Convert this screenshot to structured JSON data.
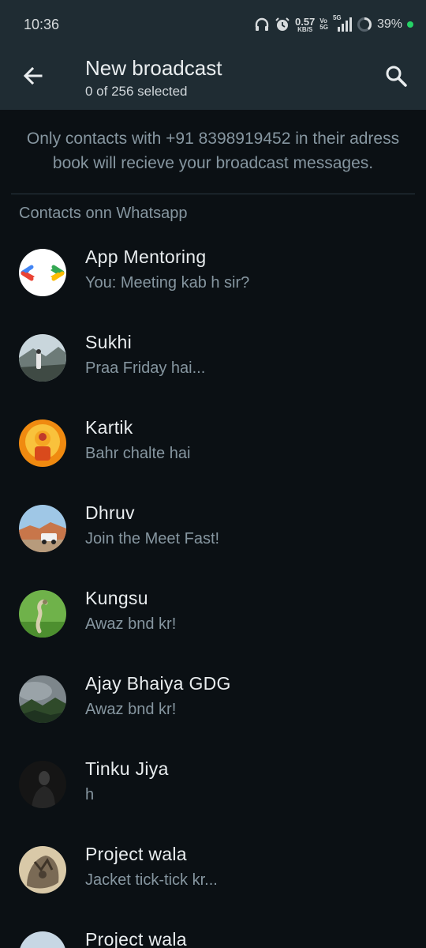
{
  "status_bar": {
    "time": "10:36",
    "speed_value": "0.57",
    "speed_unit": "KB/S",
    "volte_top": "Vo",
    "volte_bottom": "5G",
    "network": "5G",
    "battery": "39%"
  },
  "header": {
    "title": "New broadcast",
    "subtitle": "0 of 256 selected"
  },
  "notice": "Only contacts with +91 8398919452 in their adress book will recieve your broadcast messages.",
  "section_title": "Contacts onn Whatsapp",
  "contacts": [
    {
      "name": "App Mentoring",
      "message": "You: Meeting kab h sir?",
      "avatar": "code-brackets-logo"
    },
    {
      "name": "Sukhi",
      "message": "Praa Friday hai...",
      "avatar": "person-mountain-photo"
    },
    {
      "name": "Kartik",
      "message": "Bahr chalte hai",
      "avatar": "deity-photo"
    },
    {
      "name": "Dhruv",
      "message": "Join the Meet Fast!",
      "avatar": "car-desert-photo"
    },
    {
      "name": "Kungsu",
      "message": "Awaz bnd kr!",
      "avatar": "snake-photo"
    },
    {
      "name": "Ajay Bhaiya GDG",
      "message": "Awaz bnd kr!",
      "avatar": "misty-hills-photo"
    },
    {
      "name": "Tinku Jiya",
      "message": "h",
      "avatar": "dark-portrait-photo"
    },
    {
      "name": "Project wala",
      "message": "Jacket tick-tick kr...",
      "avatar": "dragon-photo"
    },
    {
      "name": "Project wala",
      "message": "",
      "avatar": "sky-photo"
    }
  ],
  "colors": {
    "background": "#0b1014",
    "header": "#1f2c33",
    "secondary_text": "#8696a0",
    "primary_text": "#e9edef",
    "battery_dot": "#25d366"
  }
}
